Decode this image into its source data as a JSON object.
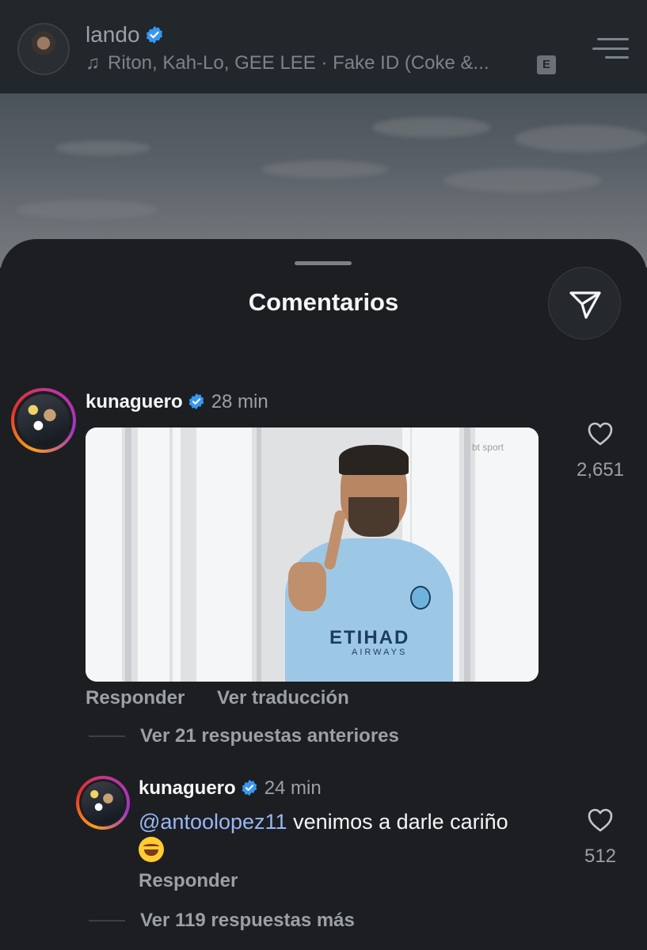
{
  "header": {
    "username": "lando",
    "song": "Riton, Kah-Lo, GEE LEE · Fake ID (Coke &...",
    "explicit_badge": "E"
  },
  "sheet": {
    "title": "Comentarios"
  },
  "comments": [
    {
      "username": "kunaguero",
      "time": "28 min",
      "gif_watermark": "bt sport",
      "gif_shirt_text": "ETIHAD",
      "gif_shirt_subtext": "AIRWAYS",
      "likes": "2,651",
      "actions": [
        "Responder",
        "Ver traducción"
      ],
      "replies_link": "Ver 21 respuestas anteriores"
    },
    {
      "username": "kunaguero",
      "time": "24 min",
      "mention": "@antoolopez11",
      "text": " venimos a darle cariño",
      "likes": "512",
      "actions": [
        "Responder"
      ],
      "replies_link": "Ver 119 respuestas más"
    }
  ],
  "colors": {
    "background": "#1c1e22",
    "mention": "#99b6f5",
    "verified": "#3897f0",
    "muted_text": "#9aa0a6"
  },
  "icons": [
    "music-note-icon",
    "verified-icon",
    "menu-icon",
    "send-icon",
    "heart-icon",
    "rolling-laughing-emoji"
  ]
}
